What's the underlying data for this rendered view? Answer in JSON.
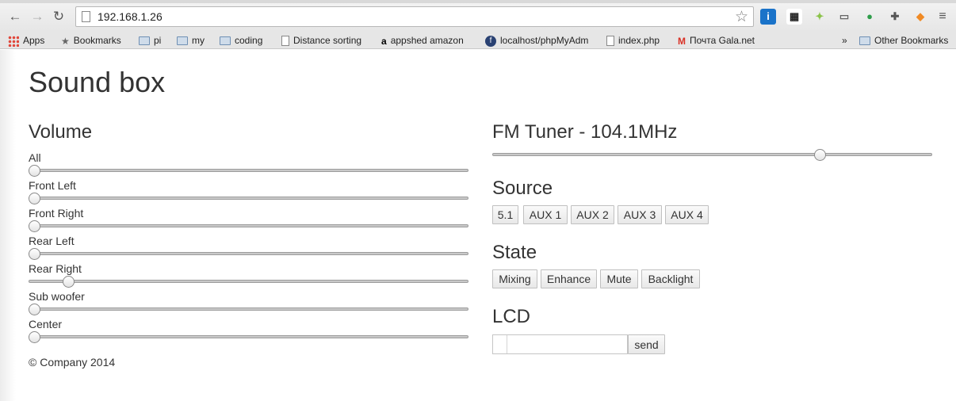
{
  "browser": {
    "url": "192.168.1.26",
    "extensions": [
      {
        "name": "info-ext-icon",
        "glyph": "i",
        "bg": "#1a73c9",
        "fg": "#fff"
      },
      {
        "name": "qr-ext-icon",
        "glyph": "▦",
        "bg": "#fff",
        "fg": "#222"
      },
      {
        "name": "android-ext-icon",
        "glyph": "✦",
        "bg": "transparent",
        "fg": "#8bc34a"
      },
      {
        "name": "cast-ext-icon",
        "glyph": "▭",
        "bg": "transparent",
        "fg": "#666"
      },
      {
        "name": "evernote-ext-icon",
        "glyph": "●",
        "bg": "transparent",
        "fg": "#2e9d4a"
      },
      {
        "name": "antenna-ext-icon",
        "glyph": "✚",
        "bg": "transparent",
        "fg": "#555"
      },
      {
        "name": "fox-ext-icon",
        "glyph": "◆",
        "bg": "transparent",
        "fg": "#f08a24"
      }
    ],
    "bookmarks": [
      {
        "label": "Apps",
        "icon": "apps-icon"
      },
      {
        "label": "Bookmarks",
        "icon": "star-icon"
      },
      {
        "label": "pi",
        "icon": "folder-icon"
      },
      {
        "label": "my",
        "icon": "folder-icon"
      },
      {
        "label": "coding",
        "icon": "folder-icon"
      },
      {
        "label": "Distance sorting",
        "icon": "file-icon"
      },
      {
        "label": "appshed amazon",
        "icon": "amazon-icon"
      },
      {
        "label": "localhost/phpMyAdm",
        "icon": "fedora-icon"
      },
      {
        "label": "index.php",
        "icon": "file-icon"
      },
      {
        "label": "Почта Gala.net",
        "icon": "gmail-icon"
      }
    ],
    "overflow": "»",
    "other_bookmarks": "Other Bookmarks"
  },
  "page": {
    "title": "Sound box",
    "volume": {
      "heading": "Volume",
      "channels": [
        {
          "label": "All",
          "level": 0
        },
        {
          "label": "Front Left",
          "level": 0
        },
        {
          "label": "Front Right",
          "level": 0
        },
        {
          "label": "Rear Left",
          "level": 0
        },
        {
          "label": "Rear Right",
          "level": 0.08
        },
        {
          "label": "Sub woofer",
          "level": 0
        },
        {
          "label": "Center",
          "level": 0
        }
      ]
    },
    "tuner": {
      "heading": "FM Tuner - 104.1MHz",
      "level": 0.75
    },
    "source": {
      "heading": "Source",
      "buttons": [
        "5.1",
        "AUX 1",
        "AUX 2",
        "AUX 3",
        "AUX 4"
      ]
    },
    "state": {
      "heading": "State",
      "buttons": [
        "Mixing",
        "Enhance",
        "Mute",
        "Backlight"
      ]
    },
    "lcd": {
      "heading": "LCD",
      "input_value": "",
      "send_label": "send"
    },
    "footer": "© Company 2014"
  }
}
